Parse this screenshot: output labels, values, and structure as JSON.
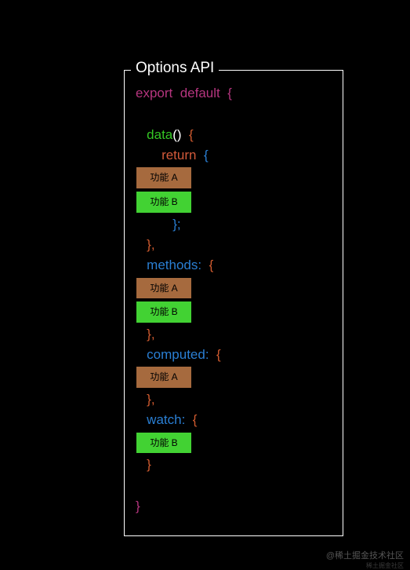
{
  "panel": {
    "title": "Options API"
  },
  "code": {
    "export": "export",
    "default": "default",
    "brace_open": "{",
    "brace_close": "}",
    "data_fn": "data",
    "parens": "()",
    "return": "return",
    "semicolon": ";",
    "comma": ",",
    "methods": "methods:",
    "computed": "computed:",
    "watch": "watch:"
  },
  "badges": {
    "a": "功能 A",
    "b": "功能 B"
  },
  "watermark": {
    "main": "@稀土掘金技术社区",
    "sub": "稀土掘金社区"
  }
}
